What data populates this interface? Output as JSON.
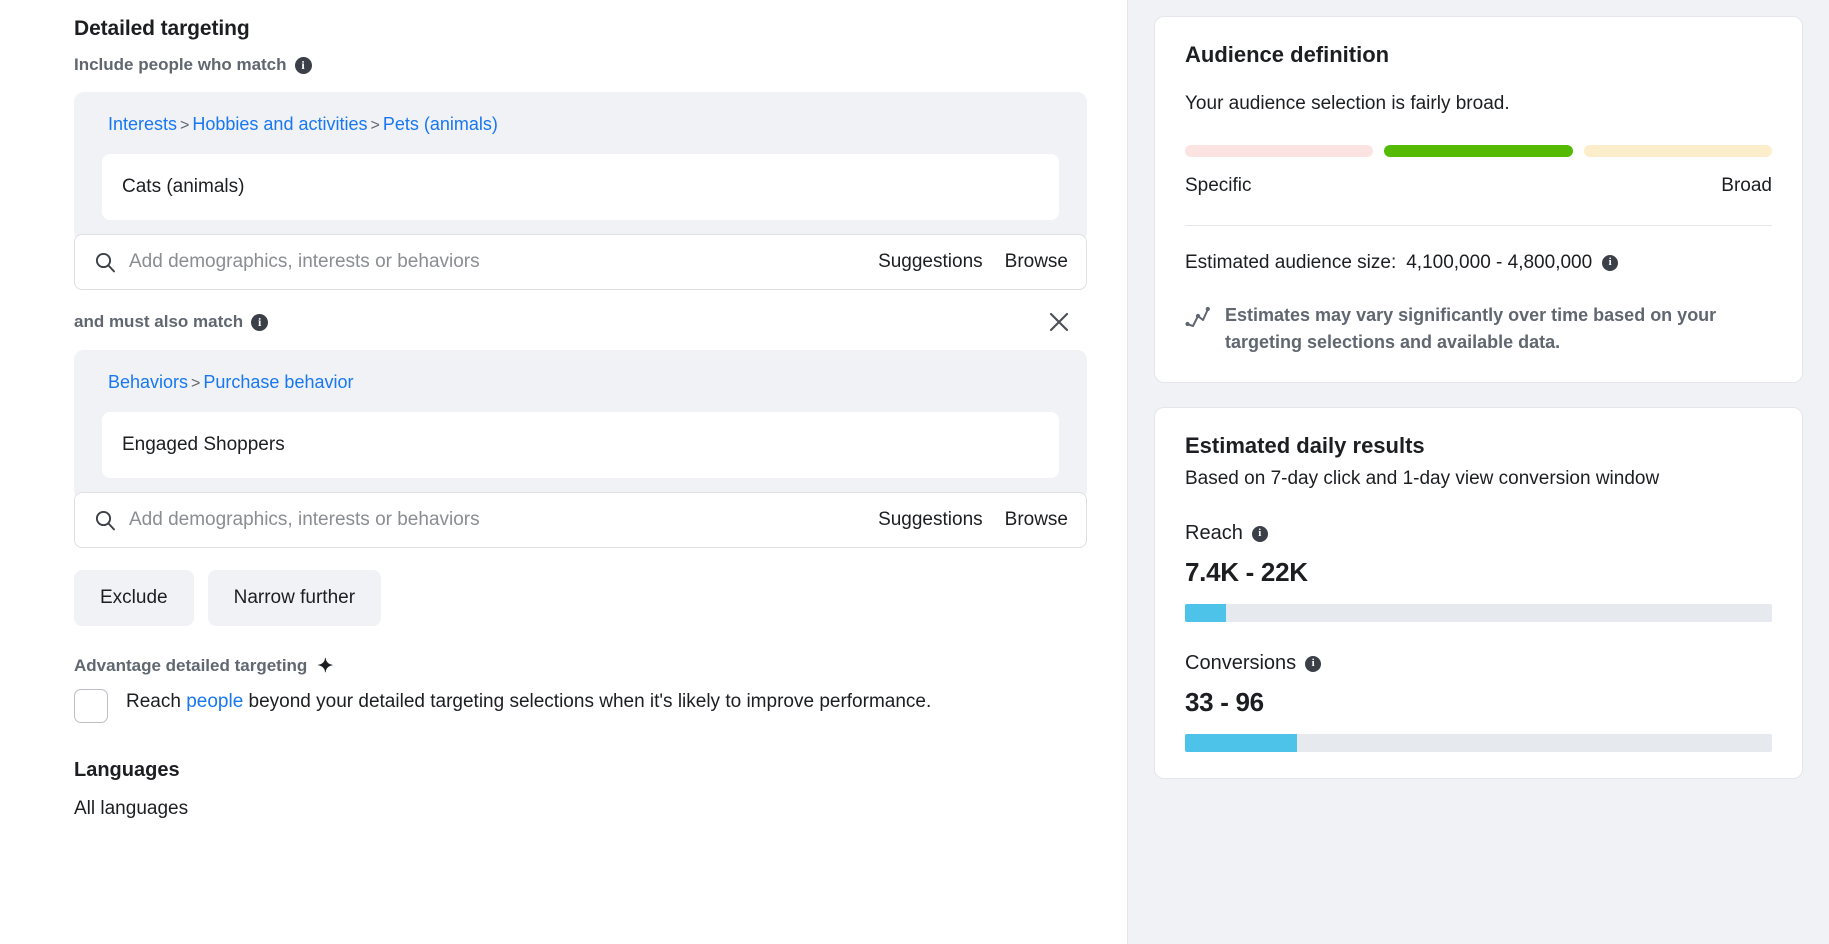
{
  "left": {
    "section_title": "Detailed targeting",
    "include_label": "Include people who match",
    "include_info_icon": "info-icon",
    "group_1": {
      "breadcrumb": [
        {
          "label": "Interests",
          "sep": ">"
        },
        {
          "label": "Hobbies and activities",
          "sep": ">"
        },
        {
          "label": "Pets (animals)",
          "sep": ""
        }
      ],
      "breadcrumb_text": "Interests > Hobbies and activities > Pets (animals)",
      "crumb_1": "Interests",
      "crumb_2": "Hobbies and activities",
      "crumb_3": "Pets (animals)",
      "separator": ">",
      "selected_chip": "Cats (animals)",
      "search_placeholder": "Add demographics, interests or behaviors",
      "suggestions_label": "Suggestions",
      "browse_label": "Browse",
      "search_icon": "search-icon"
    },
    "must_also_match_label": "and must also match",
    "must_also_match_info_icon": "info-icon",
    "remove_icon": "close-icon",
    "group_2": {
      "crumb_1": "Behaviors",
      "crumb_2": "Purchase behavior",
      "separator": ">",
      "breadcrumb_text": "Behaviors > Purchase behavior",
      "selected_chip": "Engaged Shoppers",
      "search_placeholder": "Add demographics, interests or behaviors",
      "suggestions_label": "Suggestions",
      "browse_label": "Browse",
      "search_icon": "search-icon"
    },
    "exclude_button": "Exclude",
    "narrow_further_button": "Narrow further",
    "advantage": {
      "heading": "Advantage detailed targeting",
      "sparkle_icon": "sparkle-icon",
      "checkbox_checked": false,
      "text_before_link": "Reach ",
      "link_text": "people",
      "text_after_link": " beyond your detailed targeting selections when it's likely to improve performance."
    },
    "languages": {
      "title": "Languages",
      "value": "All languages"
    }
  },
  "right": {
    "audience_card": {
      "title": "Audience definition",
      "description": "Your audience selection is fairly broad.",
      "gauge_segments": [
        {
          "name": "specific",
          "color": "#fbe3e1",
          "active": false
        },
        {
          "name": "middle",
          "color": "#54ba04",
          "active": true
        },
        {
          "name": "broad",
          "color": "#fceecb",
          "active": false
        }
      ],
      "gauge_left_label": "Specific",
      "gauge_right_label": "Broad",
      "estimated_size_label": "Estimated audience size:",
      "estimated_size_value": "4,100,000 - 4,800,000",
      "size_info_icon": "info-icon",
      "note_icon": "trend-line-icon",
      "note_text": "Estimates may vary significantly over time based on your targeting selections and available data."
    },
    "results_card": {
      "title": "Estimated daily results",
      "subtitle": "Based on 7-day click and 1-day view conversion window",
      "metrics": [
        {
          "label": "Reach",
          "info_icon": "info-icon",
          "value": "7.4K - 22K",
          "fill_percent": 7,
          "fill_color": "#4ec3ea"
        },
        {
          "label": "Conversions",
          "info_icon": "info-icon",
          "value": "33 - 96",
          "fill_percent": 19,
          "fill_color": "#4ec3ea"
        }
      ]
    }
  }
}
